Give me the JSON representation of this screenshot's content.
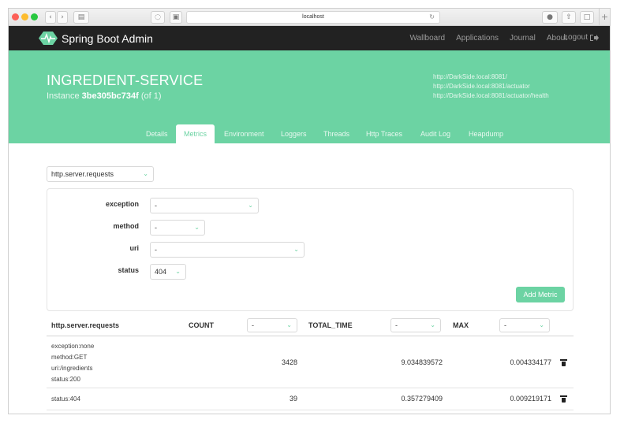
{
  "browser": {
    "address": "localhost",
    "reload_icon": "reload-icon"
  },
  "nav": {
    "brand": "Spring Boot Admin",
    "links": [
      "Wallboard",
      "Applications",
      "Journal",
      "About"
    ],
    "logout": "Logout"
  },
  "instance": {
    "name": "INGREDIENT-SERVICE",
    "instance_prefix": "Instance",
    "instance_id": "3be305bc734f",
    "instance_suffix": "(of 1)",
    "urls": [
      "http://DarkSide.local:8081/",
      "http://DarkSide.local:8081/actuator",
      "http://DarkSide.local:8081/actuator/health"
    ]
  },
  "tabs": [
    "Details",
    "Metrics",
    "Environment",
    "Loggers",
    "Threads",
    "Http Traces",
    "Audit Log",
    "Heapdump"
  ],
  "active_tab": "Metrics",
  "metric_select": {
    "value": "http.server.requests"
  },
  "filters": {
    "exception": {
      "label": "exception",
      "value": "-"
    },
    "method": {
      "label": "method",
      "value": "-"
    },
    "uri": {
      "label": "uri",
      "value": "-"
    },
    "status": {
      "label": "status",
      "value": "404"
    },
    "add_label": "Add Metric"
  },
  "table": {
    "title": "http.server.requests",
    "col_count": "COUNT",
    "col_count_select": "-",
    "col_total": "TOTAL_TIME",
    "col_total_select": "-",
    "col_max": "MAX",
    "col_max_select": "-",
    "rows": [
      {
        "tags": [
          "exception:none",
          "method:GET",
          "uri:/ingredients",
          "status:200"
        ],
        "count": "3428",
        "total_time": "9.034839572",
        "max": "0.004334177"
      },
      {
        "tags": [
          "status:404"
        ],
        "count": "39",
        "total_time": "0.357279409",
        "max": "0.009219171"
      }
    ]
  },
  "colors": {
    "accent": "#6cd3a3",
    "navbar": "#222222"
  }
}
